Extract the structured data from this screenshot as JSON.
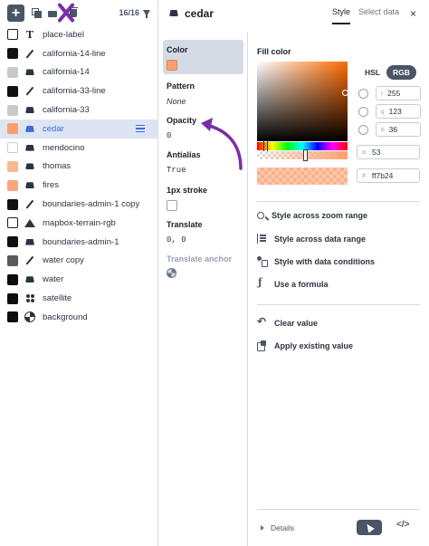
{
  "toolbar": {
    "count": "16/16"
  },
  "layers": [
    {
      "name": "place-label",
      "color": "#ffffff",
      "swatch": "outline",
      "type": "symbol"
    },
    {
      "name": "california-14-line",
      "color": "#111111",
      "swatch": "solid",
      "type": "line"
    },
    {
      "name": "california-14",
      "color": "#c8c8c8",
      "swatch": "light",
      "type": "fill"
    },
    {
      "name": "california-33-line",
      "color": "#111111",
      "swatch": "solid",
      "type": "line"
    },
    {
      "name": "california-33",
      "color": "#c8c8c8",
      "swatch": "light",
      "type": "fill"
    },
    {
      "name": "cedar",
      "color": "#ff9f6e",
      "swatch": "solid",
      "type": "fill",
      "selected": true
    },
    {
      "name": "mendocino",
      "color": "#ffffff",
      "swatch": "light",
      "type": "fill"
    },
    {
      "name": "thomas",
      "color": "#fbb892",
      "swatch": "solid",
      "type": "fill"
    },
    {
      "name": "fires",
      "color": "#f9a77f",
      "swatch": "solid",
      "type": "fill"
    },
    {
      "name": "boundaries-admin-1 copy",
      "color": "#111111",
      "swatch": "solid",
      "type": "line"
    },
    {
      "name": "mapbox-terrain-rgb",
      "color": "#ffffff",
      "swatch": "outline",
      "type": "hillshade"
    },
    {
      "name": "boundaries-admin-1",
      "color": "#111111",
      "swatch": "solid",
      "type": "fill"
    },
    {
      "name": "water copy",
      "color": "#5a5a5a",
      "swatch": "solid",
      "type": "line"
    },
    {
      "name": "water",
      "color": "#0d0d0d",
      "swatch": "solid",
      "type": "fill"
    },
    {
      "name": "satellite",
      "color": "#0d0d0d",
      "swatch": "solid",
      "type": "circle"
    },
    {
      "name": "background",
      "color": "#0d0d0d",
      "swatch": "solid",
      "type": "background"
    }
  ],
  "editor": {
    "layer_title": "cedar",
    "tabs": [
      "Style",
      "Select data"
    ],
    "close": "×"
  },
  "properties": {
    "color": {
      "name": "Color"
    },
    "pattern": {
      "name": "Pattern",
      "value": "None"
    },
    "opacity": {
      "name": "Opacity",
      "value": "0"
    },
    "antialias": {
      "name": "Antialias",
      "value": "True"
    },
    "px_stroke": {
      "name": "1px stroke"
    },
    "translate": {
      "name": "Translate",
      "value": "0, 0"
    },
    "translate_anchor": {
      "name": "Translate anchor"
    }
  },
  "watermark": "Text",
  "fill_color": {
    "label": "Fill color",
    "modes": [
      "HSL",
      "RGB"
    ],
    "r_key": "r",
    "r": "255",
    "g_key": "g",
    "g": "123",
    "b_key": "b",
    "b": "36",
    "alpha_key": "α",
    "alpha": "53",
    "hex_key": "#",
    "hex": "ff7b24"
  },
  "actions": {
    "zoom": "Style across zoom range",
    "data_range": "Style across data range",
    "data_conditions": "Style with data conditions",
    "formula": "Use a formula",
    "clear": "Clear value",
    "apply": "Apply existing value"
  },
  "footer": {
    "details": "Details",
    "code": "</>"
  },
  "colors": {
    "accent": "#3b6fd8",
    "annotation": "#7b2fa6",
    "fill": "#ff9f6e"
  }
}
